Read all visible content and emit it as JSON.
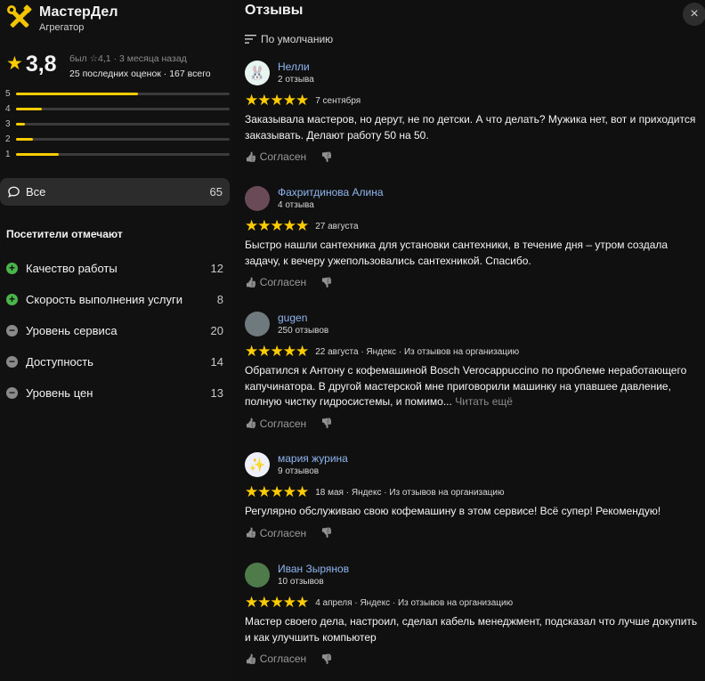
{
  "org": {
    "name": "МастерДел",
    "category": "Агрегатор"
  },
  "rating": {
    "value": "3,8",
    "was_prefix": "был",
    "was_value": "4,1",
    "was_suffix": "· 3 месяца назад",
    "counts": "25 последних оценок · 167 всего",
    "bars": [
      {
        "label": "5",
        "fraction": 0.57
      },
      {
        "label": "4",
        "fraction": 0.12
      },
      {
        "label": "3",
        "fraction": 0.04
      },
      {
        "label": "2",
        "fraction": 0.08
      },
      {
        "label": "1",
        "fraction": 0.2
      }
    ]
  },
  "filter_all": {
    "label": "Все",
    "count": "65"
  },
  "visitors": {
    "heading": "Посетители отмечают",
    "aspects": [
      {
        "label": "Качество работы",
        "count": "12",
        "kind": "plus"
      },
      {
        "label": "Скорость выполнения услуги",
        "count": "8",
        "kind": "plus"
      },
      {
        "label": "Уровень сервиса",
        "count": "20",
        "kind": "minus"
      },
      {
        "label": "Доступность",
        "count": "14",
        "kind": "minus"
      },
      {
        "label": "Уровень цен",
        "count": "13",
        "kind": "minus"
      }
    ]
  },
  "reviews_panel": {
    "title": "Отзывы",
    "close_icon": "×",
    "sort_label": "По умолчанию"
  },
  "reviews": [
    {
      "name": "Нелли",
      "sub": "2 отзыва",
      "avatar": "🐰",
      "avatar_bg": "#e8f4f0",
      "stars": "★★★★★",
      "meta": "7 сентября",
      "text": "Заказывала мастеров, но дерут, не по детски. А что делать? Мужика нет, вот и приходится заказывать. Делают работу 50 на 50.",
      "read_more": "",
      "agree": "Согласен"
    },
    {
      "name": "Фахритдинова Алина",
      "sub": "4 отзыва",
      "avatar": "",
      "avatar_bg": "#6b4a58",
      "stars": "★★★★★",
      "meta": "27 августа",
      "text": "Быстро нашли сантехника для установки сантехники, в течение дня – утром создала задачу, к вечеру ужепользовались сантехникой. Спасибо.",
      "read_more": "",
      "agree": "Согласен"
    },
    {
      "name": "gugen",
      "sub": "250 отзывов",
      "avatar": "",
      "avatar_bg": "#6f7a7e",
      "stars": "★★★★★",
      "meta": "22 августа · Яндекс · Из отзывов на организацию",
      "text": "Обратился к Антону с кофемашиной Bosch Verocappuccino по проблеме неработающего капучинатора. В другой мастерской мне приговорили машинку на упавшее давление, полную чистку гидросистемы, и помимо...",
      "read_more": "Читать ещё",
      "agree": "Согласен"
    },
    {
      "name": "мария журина",
      "sub": "9 отзывов",
      "avatar": "✨",
      "avatar_bg": "#eef0fb",
      "stars": "★★★★★",
      "meta": "18 мая · Яндекс · Из отзывов на организацию",
      "text": "Регулярно обслуживаю свою кофемашину в этом сервисе! Всё супер! Рекомендую!",
      "read_more": "",
      "agree": "Согласен"
    },
    {
      "name": "Иван Зырянов",
      "sub": "10 отзывов",
      "avatar": "",
      "avatar_bg": "#4f7a4a",
      "stars": "★★★★★",
      "meta": "4 апреля · Яндекс · Из отзывов на организацию",
      "text": "Мастер своего дела, настроил, сделал кабель менеджмент, подсказал что лучше докупить и как улучшить компьютер",
      "read_more": "",
      "agree": "Согласен"
    }
  ],
  "colors": {
    "accent": "#ffcc00",
    "link": "#8fb6ef",
    "plus": "#4ab54a",
    "minus": "#8a8a8a"
  }
}
